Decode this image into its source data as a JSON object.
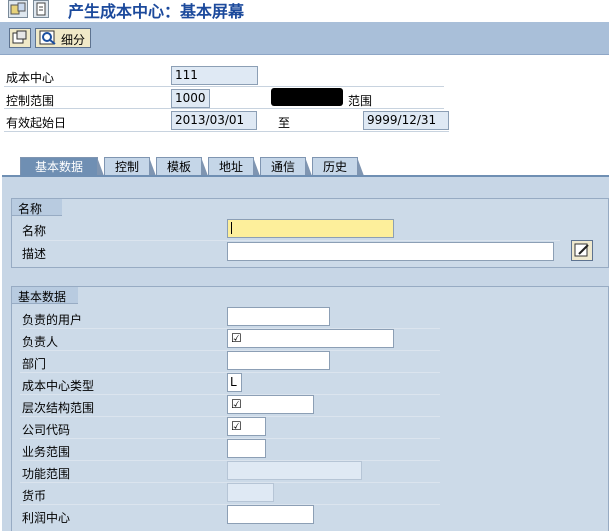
{
  "window": {
    "title": "产生成本中心：基本屏幕"
  },
  "toolbar": {
    "detail_label": "细分"
  },
  "header": {
    "cost_center_label": "成本中心",
    "cost_center_value": "111",
    "controlling_area_label": "控制范围",
    "controlling_area_value": "1000",
    "controlling_area_desc": "范围",
    "valid_from_label": "有效起始日",
    "valid_from_value": "2013/03/01",
    "to_label": "至",
    "valid_to_value": "9999/12/31"
  },
  "tabs": [
    "基本数据",
    "控制",
    "模板",
    "地址",
    "通信",
    "历史"
  ],
  "names_group": {
    "title": "名称",
    "name_label": "名称",
    "name_value": "",
    "description_label": "描述",
    "description_value": ""
  },
  "basic_group": {
    "title": "基本数据",
    "fields": [
      {
        "label": "负责的用户",
        "value": ""
      },
      {
        "label": "负责人",
        "value": "☑"
      },
      {
        "label": "部门",
        "value": ""
      },
      {
        "label": "成本中心类型",
        "value": "L"
      },
      {
        "label": "层次结构范围",
        "value": "☑"
      },
      {
        "label": "公司代码",
        "value": "☑"
      },
      {
        "label": "业务范围",
        "value": ""
      },
      {
        "label": "功能范围",
        "value": ""
      },
      {
        "label": "货币",
        "value": ""
      },
      {
        "label": "利润中心",
        "value": ""
      }
    ]
  }
}
